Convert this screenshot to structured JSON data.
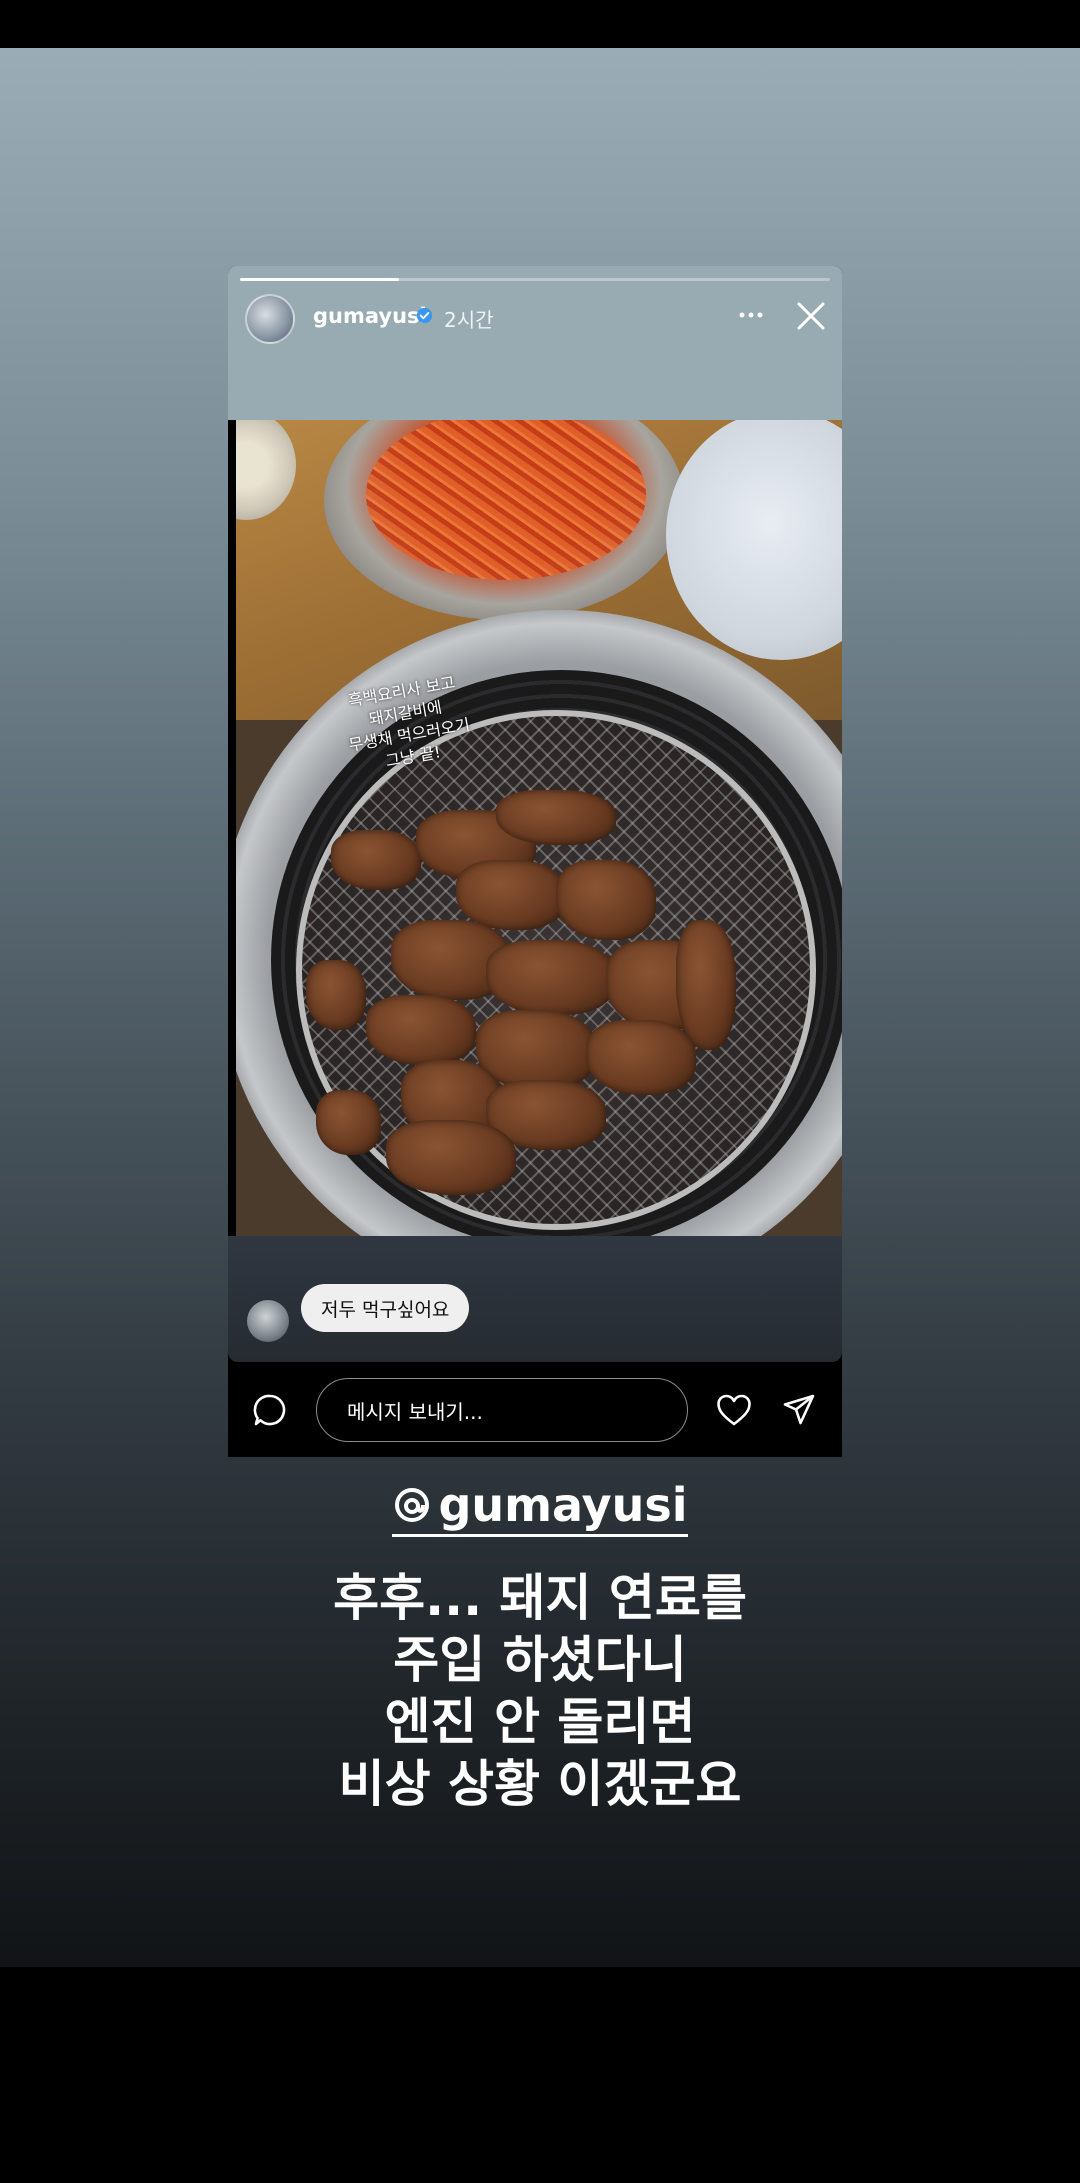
{
  "story": {
    "username": "gumayusi",
    "time": "2시간",
    "progress_fraction": 0.27,
    "photo_caption": [
      "흑백요리사 보고",
      "돼지갈비에",
      "무생채 먹으러오기",
      "그냥 끝!"
    ],
    "reply": {
      "text": "저두 먹구싶어요"
    },
    "message_placeholder": "메시지 보내기..."
  },
  "post": {
    "handle": "gumayusi",
    "comment_lines": [
      "후후... 돼지 연료를",
      "주입 하셨다니",
      "엔진 안 돌리면",
      "비상 상황 이겠군요"
    ]
  },
  "icons": {
    "verified": "verified-badge-icon",
    "more": "more-dots-icon",
    "close": "close-icon",
    "comment": "comment-bubble-icon",
    "like": "heart-icon",
    "send": "send-icon",
    "threads": "threads-logo-icon"
  },
  "colors": {
    "verified_blue": "#3897f0",
    "story_top_bg": "#98aab2"
  }
}
